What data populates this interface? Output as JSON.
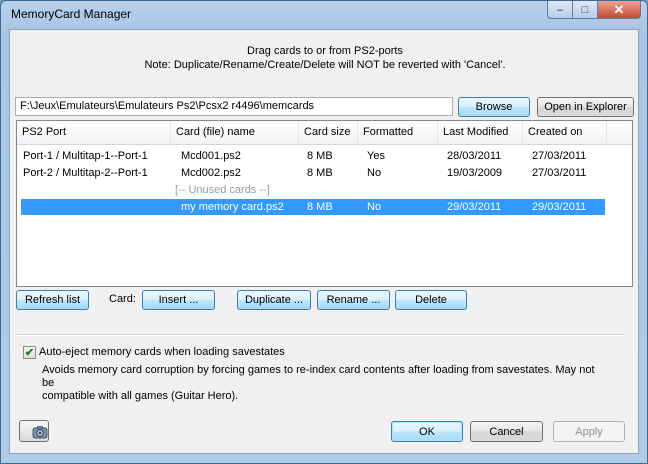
{
  "window": {
    "title": "MemoryCard Manager",
    "controls": {
      "minimize": "–",
      "maximize": "□",
      "close": "✕"
    }
  },
  "hint": {
    "line1": "Drag cards to or from PS2-ports",
    "line2": "Note: Duplicate/Rename/Create/Delete will NOT be reverted with 'Cancel'."
  },
  "path": {
    "value": "F:\\Jeux\\Emulateurs\\Emulateurs Ps2\\Pcsx2 r4496\\memcards",
    "browse_label": "Browse",
    "explorer_label": "Open in Explorer"
  },
  "table": {
    "columns": [
      "PS2 Port",
      "Card (file) name",
      "Card size",
      "Formatted",
      "Last Modified",
      "Created on"
    ],
    "rows": [
      {
        "port": "Port-1 / Multitap-1--Port-1",
        "name": "Mcd001.ps2",
        "size": "8 MB",
        "formatted": "Yes",
        "modified": "28/03/2011",
        "created": "27/03/2011"
      },
      {
        "port": "Port-2 / Multitap-2--Port-1",
        "name": "Mcd002.ps2",
        "size": "8 MB",
        "formatted": "No",
        "modified": "19/03/2009",
        "created": "27/03/2011"
      }
    ],
    "unused_label": "[-- Unused cards --]",
    "unused_rows": [
      {
        "port": "",
        "name": "my memory card.ps2",
        "size": "8 MB",
        "formatted": "No",
        "modified": "29/03/2011",
        "created": "29/03/2011",
        "selected": true
      }
    ]
  },
  "actions": {
    "refresh_label": "Refresh list",
    "card_label": "Card:",
    "insert_label": "Insert ...",
    "duplicate_label": "Duplicate ...",
    "rename_label": "Rename ...",
    "delete_label": "Delete"
  },
  "option": {
    "checked": true,
    "label": "Auto-eject memory cards when loading savestates",
    "desc_line1": "Avoids memory card corruption by forcing games to re-index card contents after loading from savestates.  May not be",
    "desc_line2": "compatible with all games (Guitar Hero)."
  },
  "footer": {
    "ok_label": "OK",
    "cancel_label": "Cancel",
    "apply_label": "Apply",
    "icon": "screenshot-camera-icon"
  }
}
